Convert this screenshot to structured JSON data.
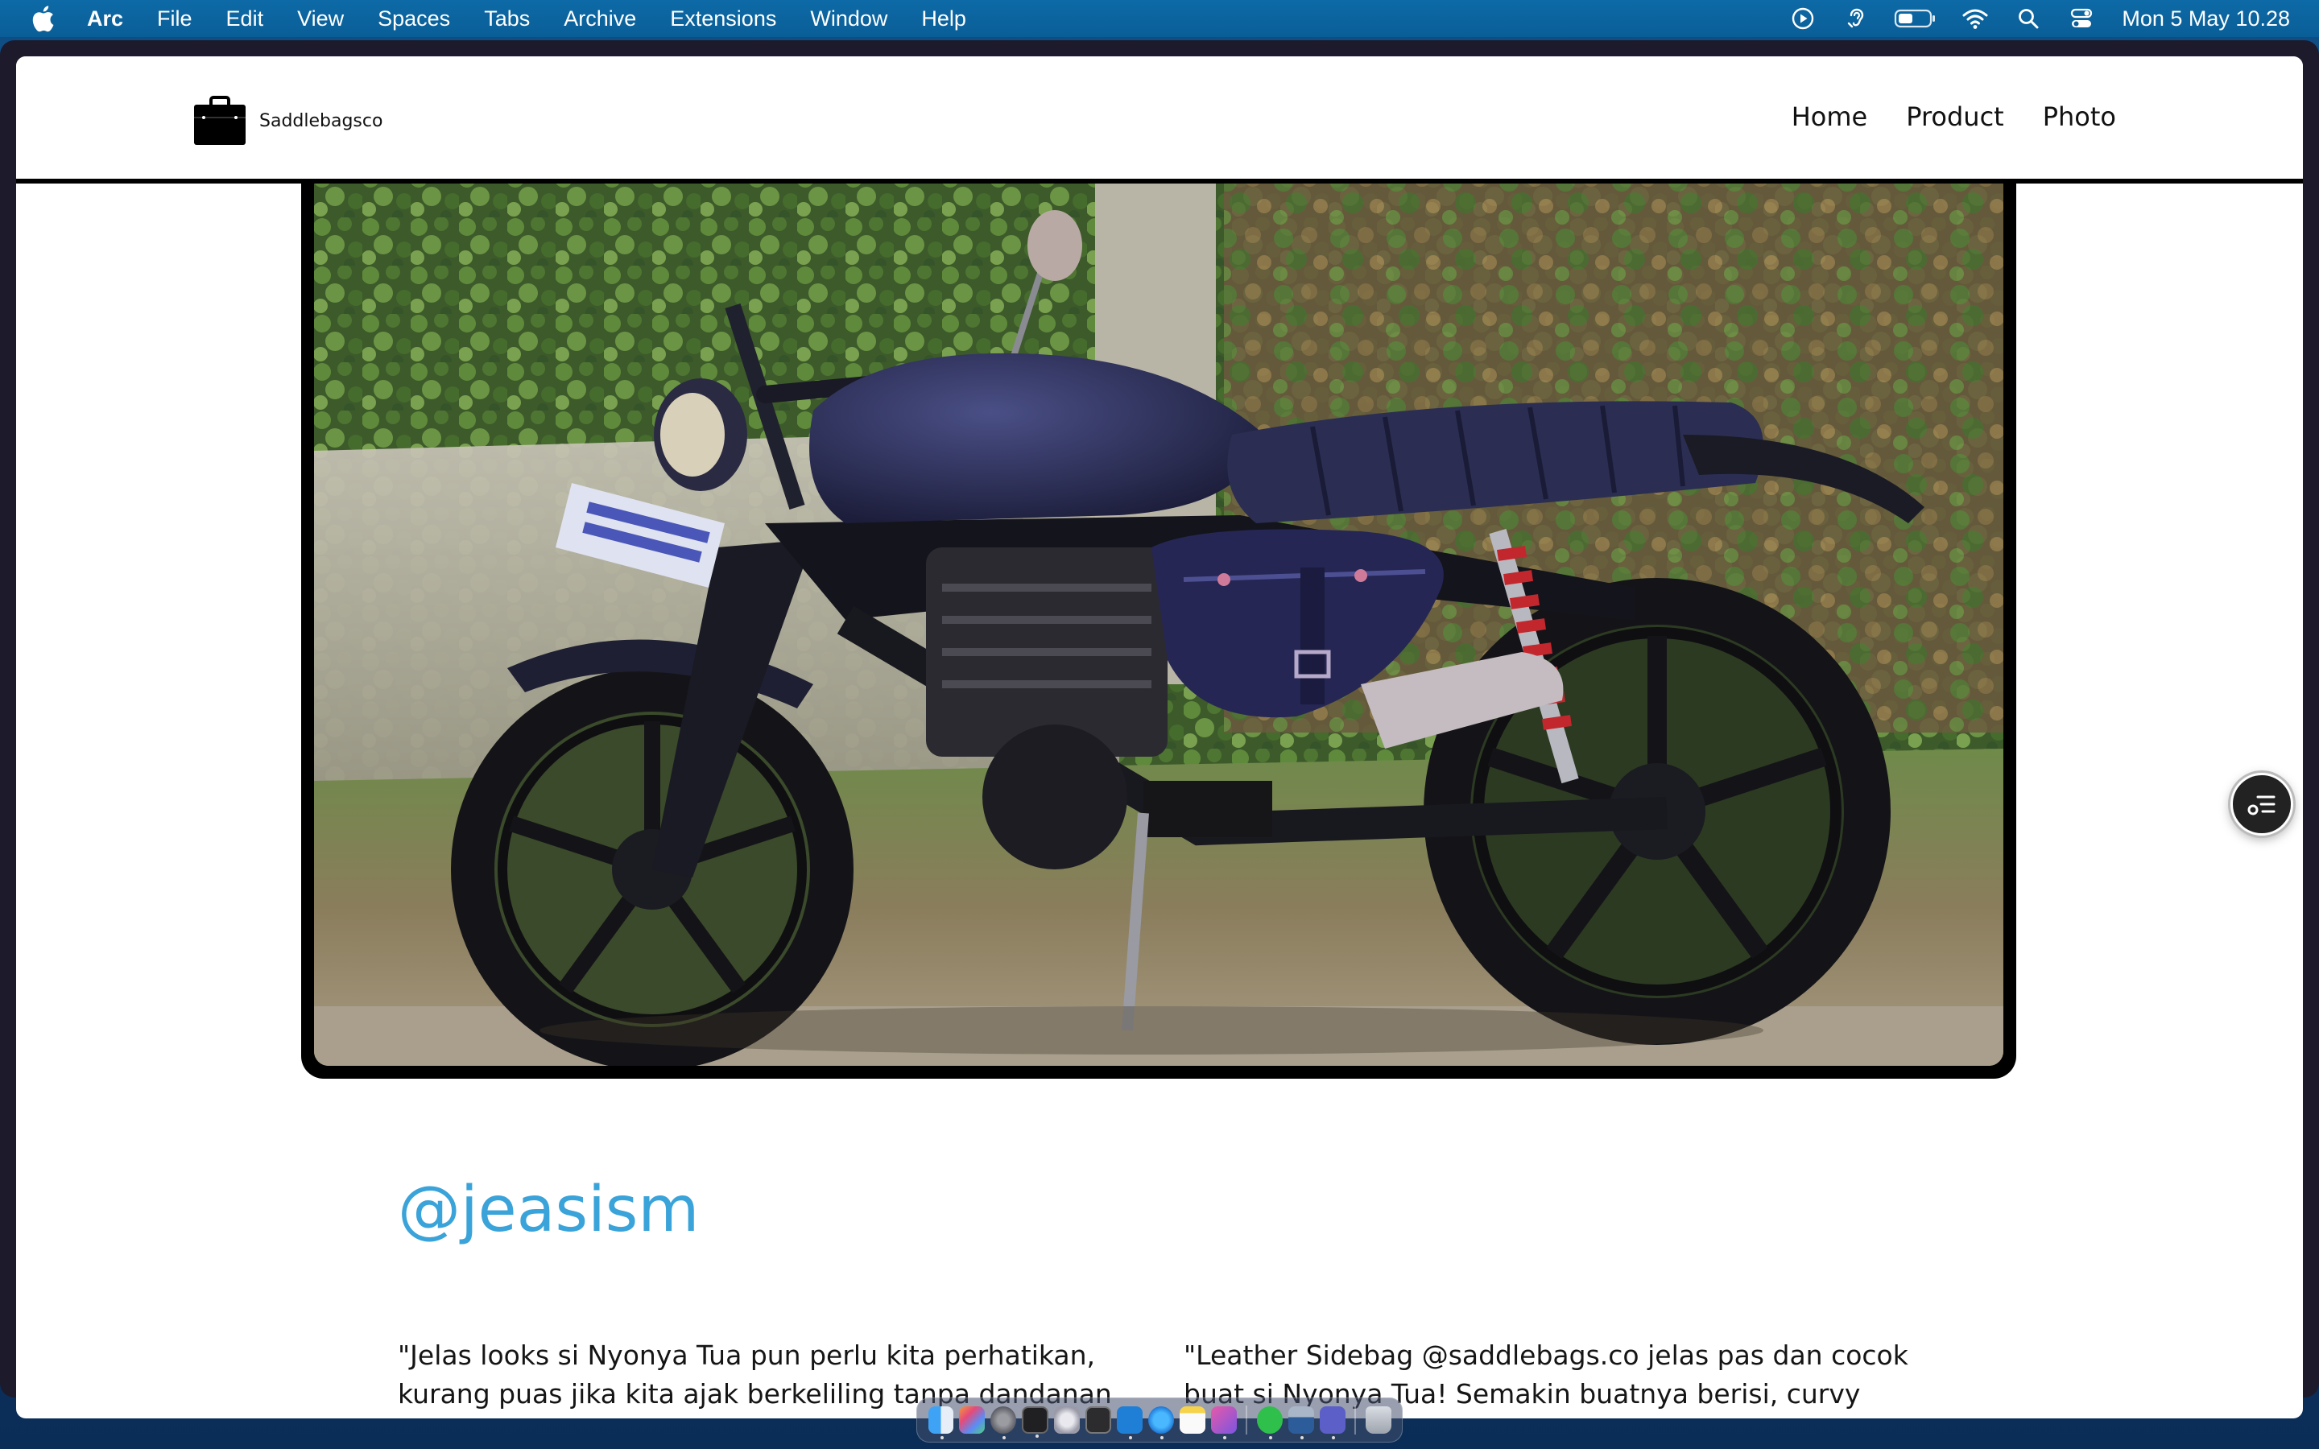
{
  "menubar": {
    "app_name": "Arc",
    "items": [
      "File",
      "Edit",
      "View",
      "Spaces",
      "Tabs",
      "Archive",
      "Extensions",
      "Window",
      "Help"
    ],
    "status_icons": [
      "play-circle-icon",
      "hearing-icon",
      "battery-icon",
      "wifi-icon",
      "search-icon",
      "control-center-icon"
    ],
    "clock": "Mon 5 May  10.28"
  },
  "site": {
    "brand_name": "Saddlebagsco",
    "nav": [
      "Home",
      "Product",
      "Photo"
    ]
  },
  "profile": {
    "handle": "@jeasism",
    "quote_left": "\"Jelas looks si Nyonya Tua pun perlu kita perhatikan, kurang puas jika kita ajak berkeliling tanpa dandanan",
    "quote_right": "\"Leather Sidebag @saddlebags.co jelas pas dan cocok buat si Nyonya Tua! Semakin buatnya berisi, curvy dan"
  },
  "dock": {
    "apps": [
      "finder-icon",
      "launchpad-icon",
      "system-settings-icon",
      "terminal-icon",
      "disk-utility-icon",
      "console-icon",
      "vscode-icon",
      "safari-icon",
      "notes-icon",
      "preview-icon",
      "whatsapp-icon",
      "remote-desktop-icon",
      "teams-icon"
    ],
    "trash": "trash-icon"
  },
  "colors": {
    "accent": "#3aa3d9",
    "menubar": "#0a5e97",
    "header_border": "#000000"
  }
}
